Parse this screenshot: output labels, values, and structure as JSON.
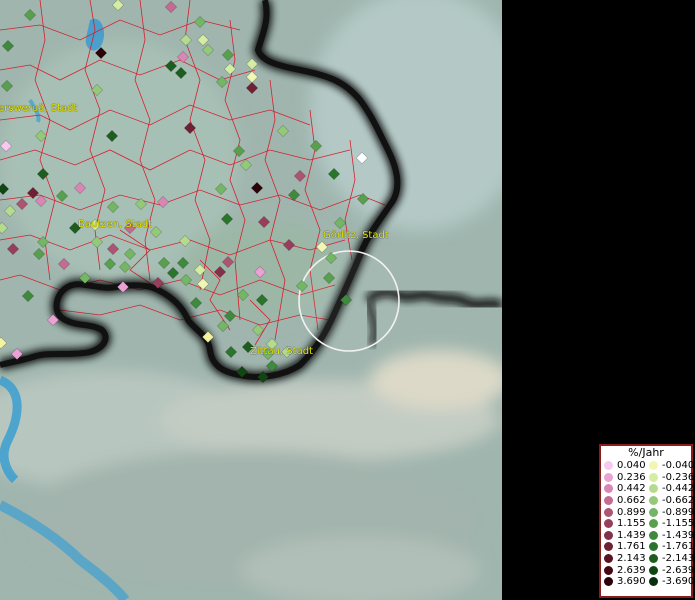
{
  "map": {
    "labels": [
      {
        "id": "hoyerswerda",
        "text": "ersweruä, Stadt"
      },
      {
        "id": "bautzen",
        "text": "Bautzen, Stadt"
      },
      {
        "id": "goerlitz",
        "text": "Görlitz, Stadt"
      },
      {
        "id": "zittau",
        "text": "Zittau, Stadt"
      }
    ]
  },
  "legend": {
    "title": "%/Jahr",
    "positive": [
      "0.040",
      "0.236",
      "0.442",
      "0.662",
      "0.899",
      "1.155",
      "1.439",
      "1.761",
      "2.143",
      "2.639",
      "3.690"
    ],
    "negative": [
      "-0.040",
      "-0.236",
      "-0.442",
      "-0.662",
      "-0.899",
      "-1.155",
      "-1.439",
      "-1.761",
      "-2.143",
      "-2.639",
      "-3.690"
    ],
    "positive_colors": [
      "#f9c8f1",
      "#eba0d6",
      "#d986b5",
      "#c46b91",
      "#ad5473",
      "#983e5d",
      "#84304a",
      "#702033",
      "#5a1222",
      "#430913",
      "#2a0208"
    ],
    "negative_colors": [
      "#f1f7b3",
      "#d5eca3",
      "#b5dc8e",
      "#94c97a",
      "#74b664",
      "#589f4e",
      "#3f8a3c",
      "#2b742b",
      "#1d5d1e",
      "#114613",
      "#06300a"
    ]
  }
}
